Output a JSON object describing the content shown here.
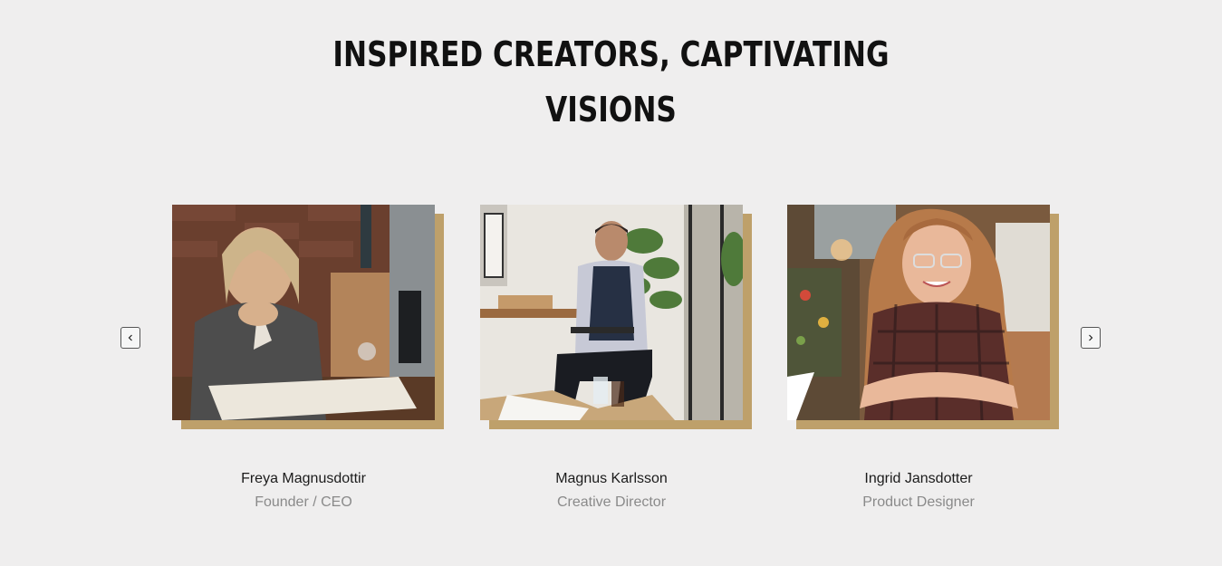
{
  "section": {
    "heading_line1": "INSPIRED CREATORS, CAPTIVATING",
    "heading_line2": "VISIONS"
  },
  "carousel": {
    "prev_icon": "chevron-left-icon",
    "next_icon": "chevron-right-icon",
    "accent_color": "#bea06a"
  },
  "team": [
    {
      "name": "Freya Magnusdottir",
      "role": "Founder / CEO"
    },
    {
      "name": "Magnus Karlsson",
      "role": "Creative Director"
    },
    {
      "name": "Ingrid Jansdotter",
      "role": "Product Designer"
    }
  ]
}
